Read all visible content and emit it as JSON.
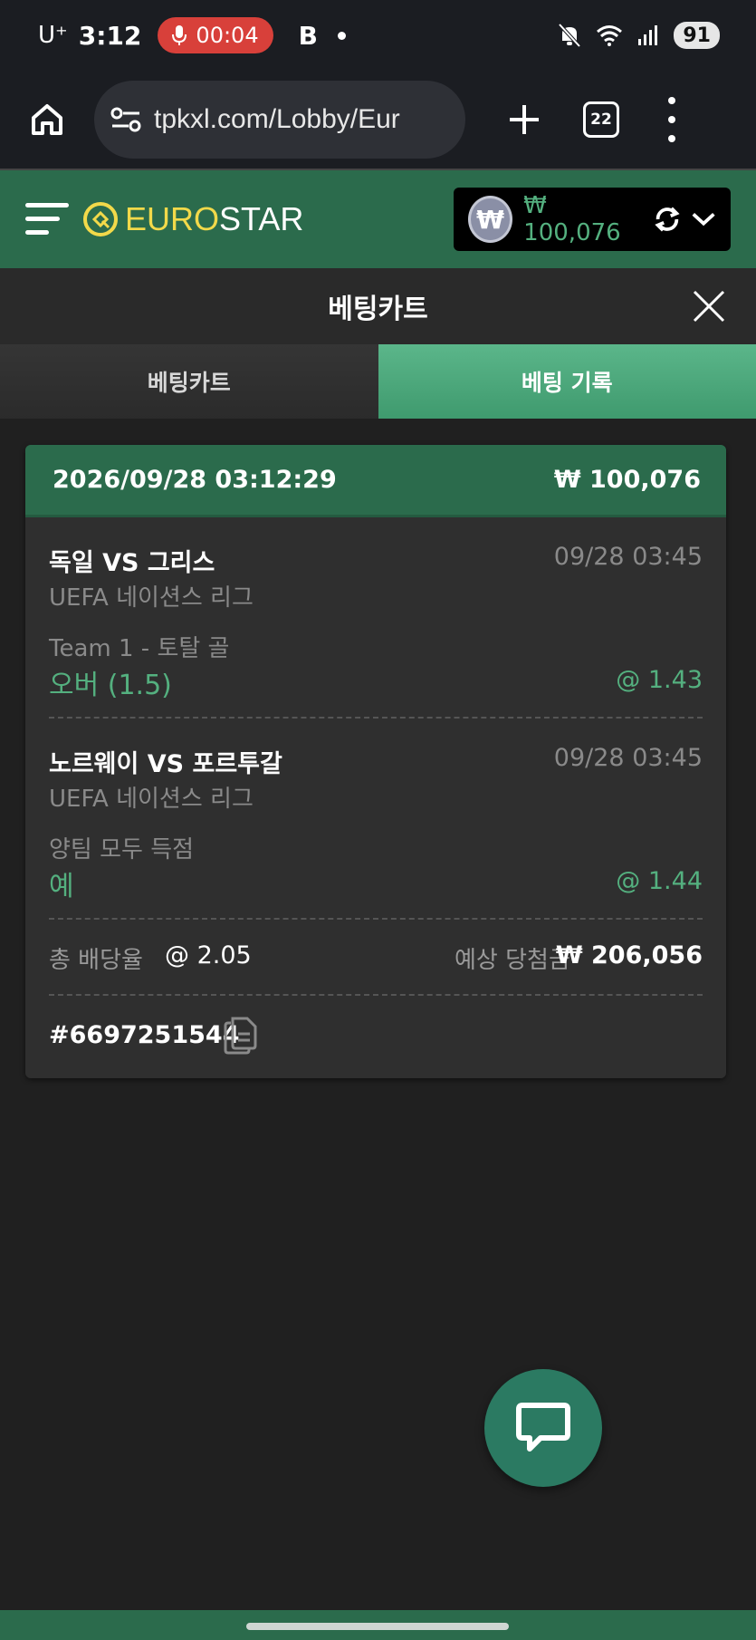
{
  "status_bar": {
    "carrier": "U⁺",
    "time": "3:12",
    "recording_time": "00:04",
    "app_badge": "B",
    "battery": "91"
  },
  "browser": {
    "url": "tpkxl.com/Lobby/Eur",
    "tab_count": "22"
  },
  "site": {
    "logo_euro": "EURO",
    "logo_star": "STAR",
    "wallet_currency_symbol": "₩",
    "balance": "₩ 100,076"
  },
  "betcart": {
    "title": "베팅카트",
    "tabs": [
      {
        "label": "베팅카트",
        "active": false
      },
      {
        "label": "베팅 기록",
        "active": true
      }
    ]
  },
  "bet": {
    "date": "2026/09/28 03:12:29",
    "stake": "₩ 100,076",
    "selections": [
      {
        "match": "독일 VS 그리스",
        "time": "09/28 03:45",
        "league": "UEFA 네이션스 리그",
        "market": "Team 1 - 토탈 골",
        "pick": "오버 (1.5)",
        "odds": "@ 1.43"
      },
      {
        "match": "노르웨이 VS 포르투갈",
        "time": "09/28 03:45",
        "league": "UEFA 네이션스 리그",
        "market": "양팀 모두 득점",
        "pick": "예",
        "odds": "@ 1.44"
      }
    ],
    "total_odds_label": "총 배당율",
    "total_odds": "@ 2.05",
    "expected_label": "예상 당첨금",
    "expected_win": "₩ 206,056",
    "ticket_id": "#6697251544"
  },
  "colors": {
    "brand_green": "#2b6b4c",
    "accent_green": "#54b07f",
    "logo_yellow": "#f2d94a",
    "record_red": "#d8403a"
  },
  "icons": [
    "mic-icon",
    "mute-icon",
    "wifi-icon",
    "signal-icon",
    "home-icon",
    "site-settings-icon",
    "plus-icon",
    "more-vert-icon",
    "hamburger-icon",
    "refresh-icon",
    "chevron-down-icon",
    "close-icon",
    "copy-icon",
    "chat-icon"
  ]
}
